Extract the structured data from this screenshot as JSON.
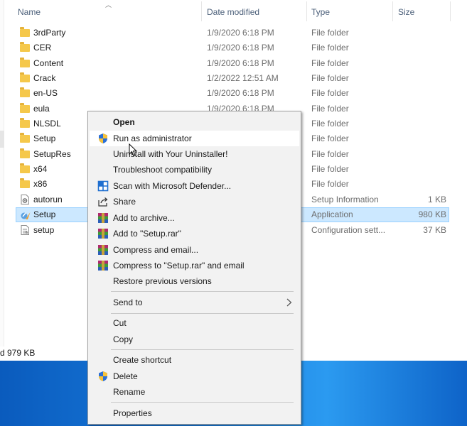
{
  "columns": {
    "name": "Name",
    "date_modified": "Date modified",
    "type": "Type",
    "size": "Size"
  },
  "files": [
    {
      "name": "3rdParty",
      "date": "1/9/2020 6:18 PM",
      "type": "File folder",
      "size": "",
      "icon": "folder-icon"
    },
    {
      "name": "CER",
      "date": "1/9/2020 6:18 PM",
      "type": "File folder",
      "size": "",
      "icon": "folder-icon"
    },
    {
      "name": "Content",
      "date": "1/9/2020 6:18 PM",
      "type": "File folder",
      "size": "",
      "icon": "folder-icon"
    },
    {
      "name": "Crack",
      "date": "1/2/2022 12:51 AM",
      "type": "File folder",
      "size": "",
      "icon": "folder-icon"
    },
    {
      "name": "en-US",
      "date": "1/9/2020 6:18 PM",
      "type": "File folder",
      "size": "",
      "icon": "folder-icon"
    },
    {
      "name": "eula",
      "date": "1/9/2020 6:18 PM",
      "type": "File folder",
      "size": "",
      "icon": "folder-icon"
    },
    {
      "name": "NLSDL",
      "date": "",
      "type": "File folder",
      "size": "",
      "icon": "folder-icon"
    },
    {
      "name": "Setup",
      "date": "",
      "type": "File folder",
      "size": "",
      "icon": "folder-icon"
    },
    {
      "name": "SetupRes",
      "date": "",
      "type": "File folder",
      "size": "",
      "icon": "folder-icon"
    },
    {
      "name": "x64",
      "date": "",
      "type": "File folder",
      "size": "",
      "icon": "folder-icon"
    },
    {
      "name": "x86",
      "date": "",
      "type": "File folder",
      "size": "",
      "icon": "folder-icon"
    },
    {
      "name": "autorun",
      "date": "",
      "type": "Setup Information",
      "size": "1 KB",
      "icon": "setup-info-file-icon"
    },
    {
      "name": "Setup",
      "date": "",
      "type": "Application",
      "size": "980 KB",
      "icon": "application-icon",
      "selected": true
    },
    {
      "name": "setup",
      "date": "",
      "type": "Configuration sett...",
      "size": "37 KB",
      "icon": "config-file-icon"
    }
  ],
  "status_bar": {
    "text": "d 979 KB"
  },
  "context_menu": {
    "open": "Open",
    "run_as_admin": "Run as administrator",
    "uninstall": "Uninstall with Your Uninstaller!",
    "troubleshoot": "Troubleshoot compatibility",
    "defender": "Scan with Microsoft Defender...",
    "share": "Share",
    "add_archive": "Add to archive...",
    "add_setup_rar": "Add to \"Setup.rar\"",
    "compress_email": "Compress and email...",
    "compress_setup_email": "Compress to \"Setup.rar\" and email",
    "restore": "Restore previous versions",
    "send_to": "Send to",
    "cut": "Cut",
    "copy": "Copy",
    "create_shortcut": "Create shortcut",
    "delete": "Delete",
    "rename": "Rename",
    "properties": "Properties"
  },
  "colors": {
    "selection": "#cce8ff",
    "selection_border": "#99d1ff",
    "menu_bg": "#f2f2f2",
    "header_text": "#4c607a",
    "folder": "#f5c84b"
  }
}
